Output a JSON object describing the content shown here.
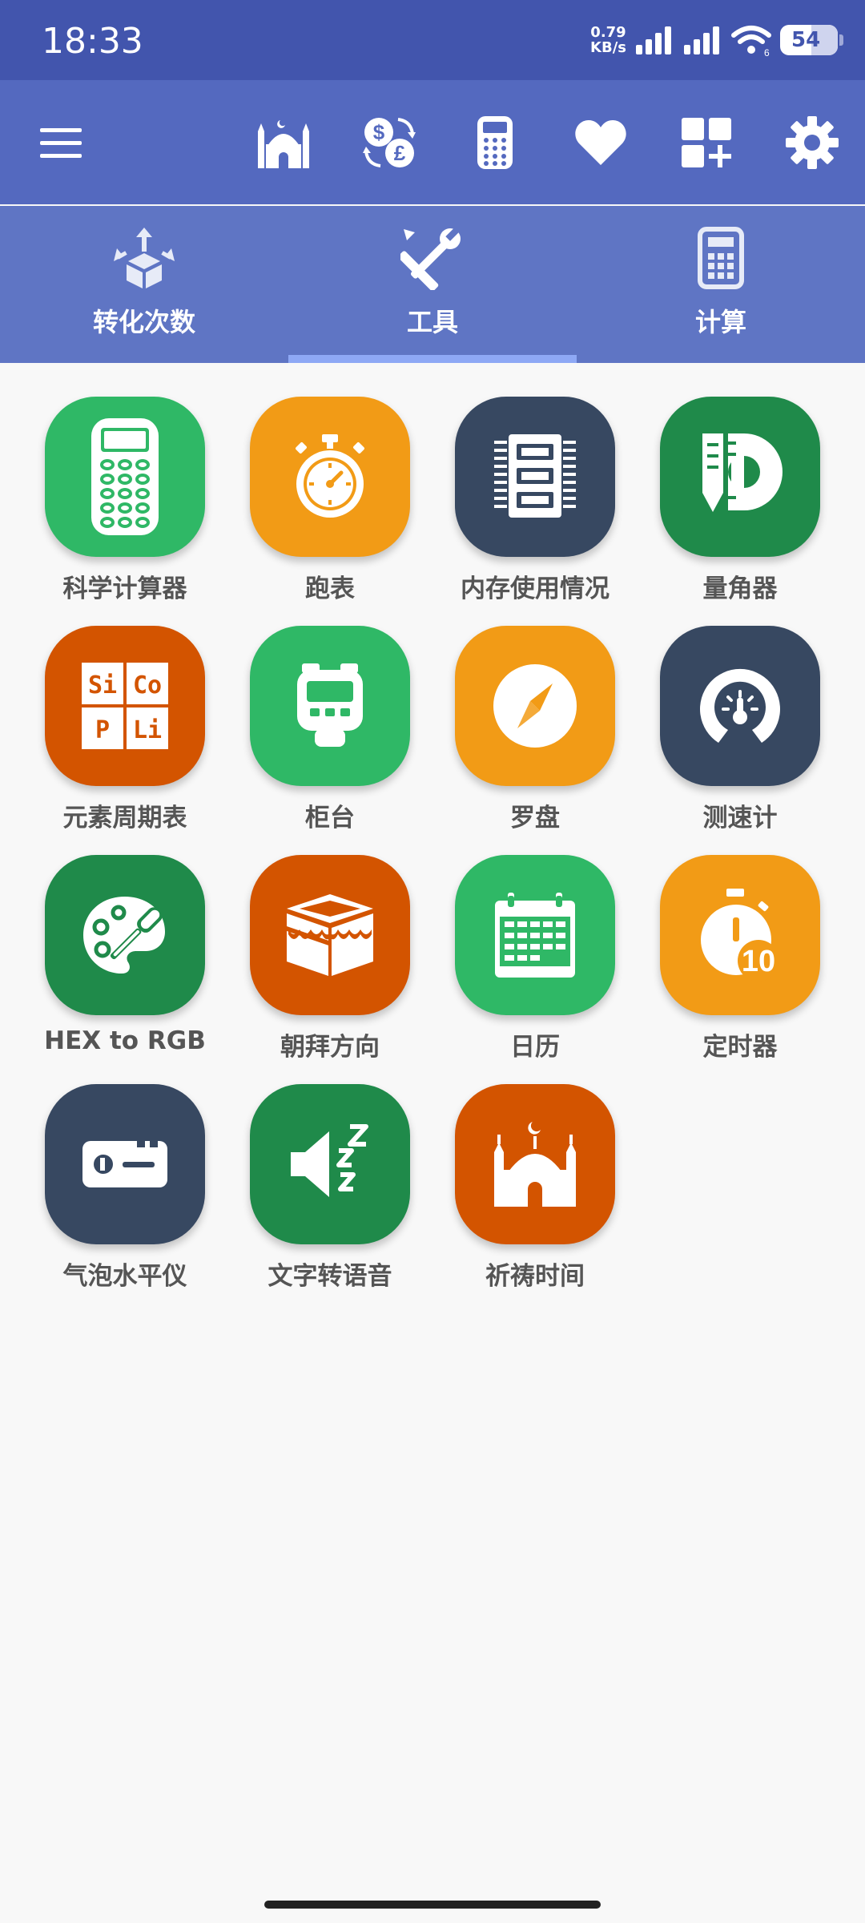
{
  "status_bar": {
    "time": "18:33",
    "net_speed_value": "0.79",
    "net_speed_unit": "KB/s",
    "battery_level": "54"
  },
  "toolbar": {
    "icons": [
      "menu-icon",
      "mosque-icon",
      "currency-exchange-icon",
      "calculator-icon",
      "heart-icon",
      "add-widget-icon",
      "settings-icon"
    ]
  },
  "tabs": [
    {
      "label": "转化次数",
      "icon": "conversion-box-icon",
      "selected": false
    },
    {
      "label": "工具",
      "icon": "tools-icon",
      "selected": true
    },
    {
      "label": "计算",
      "icon": "calculator-icon",
      "selected": false
    }
  ],
  "tools": [
    {
      "label": "科学计算器",
      "icon": "scientific-calculator-icon",
      "color": "#2fb866"
    },
    {
      "label": "跑表",
      "icon": "stopwatch-icon",
      "color": "#f29b16"
    },
    {
      "label": "内存使用情况",
      "icon": "memory-chip-icon",
      "color": "#374861"
    },
    {
      "label": "量角器",
      "icon": "protractor-icon",
      "color": "#1f8a4a"
    },
    {
      "label": "元素周期表",
      "icon": "periodic-table-icon",
      "color": "#d35400"
    },
    {
      "label": "柜台",
      "icon": "counter-icon",
      "color": "#2fb866"
    },
    {
      "label": "罗盘",
      "icon": "compass-icon",
      "color": "#f29b16"
    },
    {
      "label": "测速计",
      "icon": "speedometer-icon",
      "color": "#374861"
    },
    {
      "label": "HEX to RGB",
      "icon": "palette-icon",
      "color": "#1f8a4a"
    },
    {
      "label": "朝拜方向",
      "icon": "kaaba-icon",
      "color": "#d35400"
    },
    {
      "label": "日历",
      "icon": "calendar-icon",
      "color": "#2fb866"
    },
    {
      "label": "定时器",
      "icon": "timer-icon",
      "color": "#f29b16"
    },
    {
      "label": "气泡水平仪",
      "icon": "bubble-level-icon",
      "color": "#374861"
    },
    {
      "label": "文字转语音",
      "icon": "text-to-speech-icon",
      "color": "#1f8a4a"
    },
    {
      "label": "祈祷时间",
      "icon": "prayer-time-icon",
      "color": "#d35400"
    }
  ],
  "periodic_symbols": [
    "Si",
    "Co",
    "P",
    "Li"
  ],
  "timer_number": "10"
}
